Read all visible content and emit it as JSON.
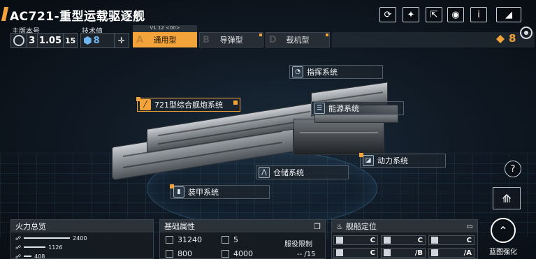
{
  "header": {
    "title": "AC721-重型运载驱逐舰",
    "tools": [
      {
        "name": "refresh-icon",
        "glyph": "⟳"
      },
      {
        "name": "camera-icon",
        "glyph": "✦"
      },
      {
        "name": "share-icon",
        "glyph": "⇱"
      },
      {
        "name": "eye-icon",
        "glyph": "◉"
      },
      {
        "name": "info-icon",
        "glyph": "i"
      },
      {
        "name": "back-icon",
        "glyph": "◢"
      }
    ]
  },
  "info": {
    "main_version_label": "主版本号",
    "main_version_number": "3",
    "sub_version": "1.05",
    "sub_version_suffix": "15",
    "tech_label": "技术值",
    "tech_value": "8"
  },
  "version_tag": "V1.12 <00>",
  "types": [
    {
      "letter": "A",
      "label": "通用型",
      "active": true
    },
    {
      "letter": "B",
      "label": "导弹型",
      "active": false
    },
    {
      "letter": "D",
      "label": "载机型",
      "active": false
    }
  ],
  "currency": "8",
  "systems": {
    "command": {
      "label": "指挥系统",
      "icon": "command-icon"
    },
    "weapon": {
      "label": "721型综合舰炮系统",
      "icon": "cannon-icon"
    },
    "energy": {
      "label": "能源系统",
      "icon": "energy-icon"
    },
    "power": {
      "label": "动力系统",
      "icon": "power-icon"
    },
    "storage": {
      "label": "仓储系统",
      "icon": "storage-icon"
    },
    "armor": {
      "label": "装甲系统",
      "icon": "armor-icon"
    }
  },
  "help": "?",
  "firepower": {
    "title": "火力总览",
    "rows": [
      {
        "value": "2400",
        "fraction": 1.0
      },
      {
        "value": "1126",
        "fraction": 0.47
      },
      {
        "value": "408",
        "fraction": 0.17
      }
    ]
  },
  "attributes": {
    "title": "基础属性",
    "hp": "31240",
    "armor": "5",
    "speed": "800",
    "cargo": "4000",
    "service_label": "服役限制",
    "service_value": "-- /15"
  },
  "positioning": {
    "title": "舰船定位",
    "cells": [
      "C",
      "C",
      "C",
      "C",
      "/B",
      "/A"
    ]
  },
  "blueprint": {
    "label": "蓝图强化"
  },
  "colors": {
    "accent": "#f2a33a",
    "panel": "#161c22"
  }
}
